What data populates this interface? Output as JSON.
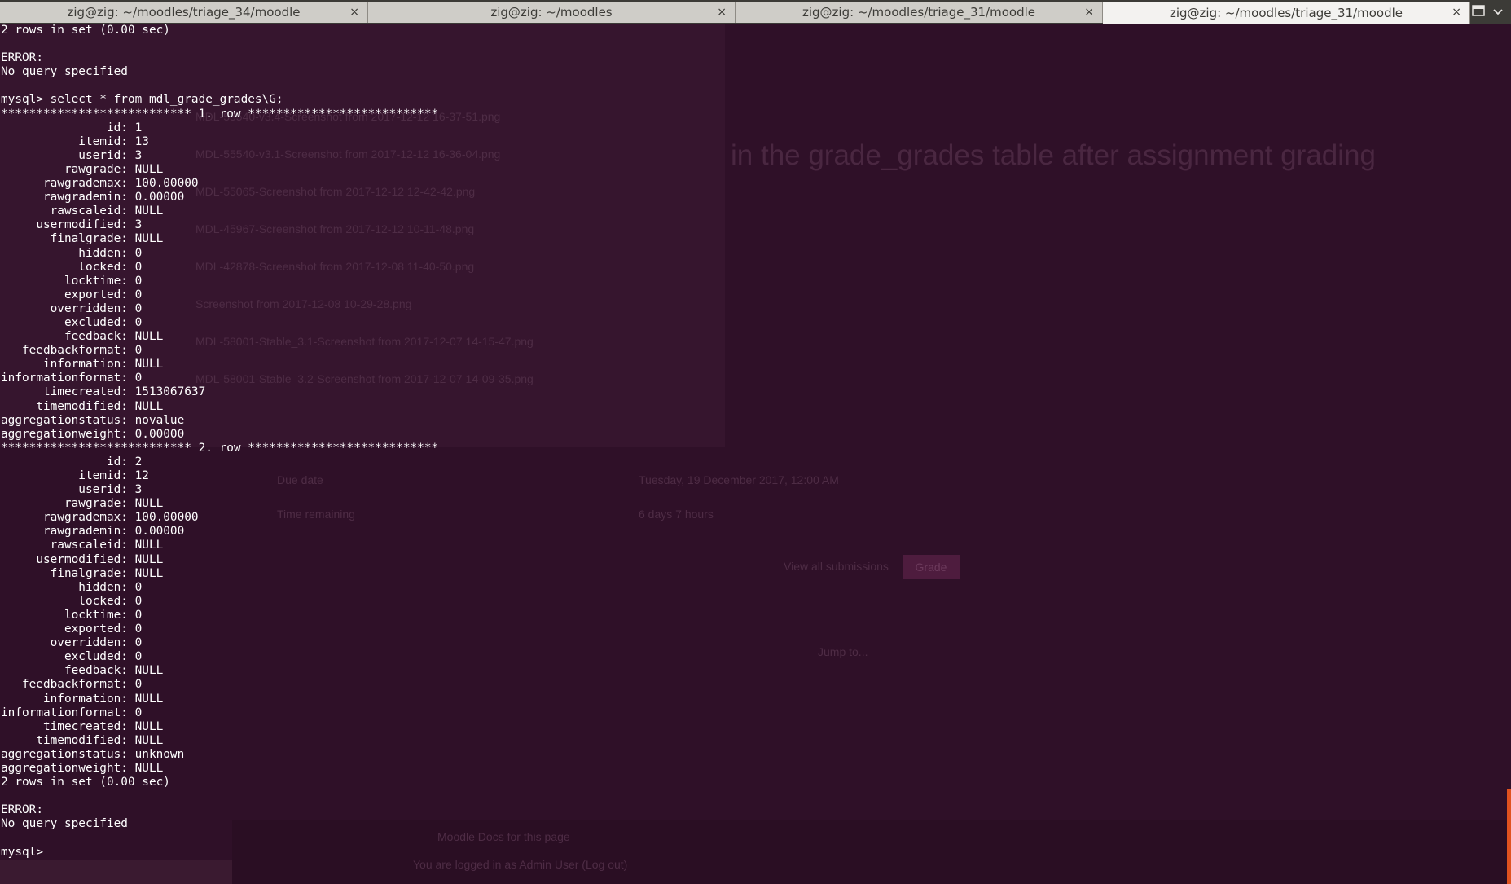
{
  "tabs": [
    {
      "title": "zig@zig: ~/moodles/triage_34/moodle",
      "active": false
    },
    {
      "title": "zig@zig: ~/moodles",
      "active": false
    },
    {
      "title": "zig@zig: ~/moodles/triage_31/moodle",
      "active": false
    },
    {
      "title": "zig@zig: ~/moodles/triage_31/moodle",
      "active": true
    }
  ],
  "close_glyph": "×",
  "tab_menu_icons": [
    "new-tab-icon",
    "chevron-down-icon"
  ],
  "colors": {
    "terminal_bg": "#2f1028",
    "terminal_text": "#ffffff",
    "tabbar_bg": "#3c3b37",
    "active_tab_bg": "#f3f2f0",
    "scrollbar_accent": "#e0521f"
  },
  "terminal": {
    "lines": [
      "2 rows in set (0.00 sec)",
      "",
      "ERROR:",
      "No query specified",
      "",
      "mysql> select * from mdl_grade_grades\\G;",
      "*************************** 1. row ***************************",
      "               id: 1",
      "           itemid: 13",
      "           userid: 3",
      "         rawgrade: NULL",
      "      rawgrademax: 100.00000",
      "      rawgrademin: 0.00000",
      "       rawscaleid: NULL",
      "     usermodified: 3",
      "       finalgrade: NULL",
      "           hidden: 0",
      "           locked: 0",
      "         locktime: 0",
      "         exported: 0",
      "       overridden: 0",
      "         excluded: 0",
      "         feedback: NULL",
      "   feedbackformat: 0",
      "      information: NULL",
      "informationformat: 0",
      "      timecreated: 1513067637",
      "     timemodified: NULL",
      "aggregationstatus: novalue",
      "aggregationweight: 0.00000",
      "*************************** 2. row ***************************",
      "               id: 2",
      "           itemid: 12",
      "           userid: 3",
      "         rawgrade: NULL",
      "      rawgrademax: 100.00000",
      "      rawgrademin: 0.00000",
      "       rawscaleid: NULL",
      "     usermodified: NULL",
      "       finalgrade: NULL",
      "           hidden: 0",
      "           locked: 0",
      "         locktime: 0",
      "         exported: 0",
      "       overridden: 0",
      "         excluded: 0",
      "         feedback: NULL",
      "   feedbackformat: 0",
      "      information: NULL",
      "informationformat: 0",
      "      timecreated: NULL",
      "     timemodified: NULL",
      "aggregationstatus: unknown",
      "aggregationweight: NULL",
      "2 rows in set (0.00 sec)",
      "",
      "ERROR:",
      "No query specified",
      "",
      "mysql> "
    ]
  },
  "background_ghost": {
    "heading": "in the grade_grades table after assignment grading",
    "files": [
      "MDL-55540-v3.4-Screenshot from 2017-12-12 16-37-51.png",
      "MDL-55540-v3.1-Screenshot from 2017-12-12 16-36-04.png",
      "MDL-55065-Screenshot from 2017-12-12 12-42-42.png",
      "MDL-45967-Screenshot from 2017-12-12 10-11-48.png",
      "MDL-42878-Screenshot from 2017-12-08 11-40-50.png",
      "Screenshot from 2017-12-08 10-29-28.png",
      "MDL-58001-Stable_3.1-Screenshot from 2017-12-07 14-15-47.png",
      "MDL-58001-Stable_3.2-Screenshot from 2017-12-07 14-09-35.png"
    ],
    "due_date_label": "Due date",
    "due_date_value": "Tuesday, 19 December 2017, 12:00 AM",
    "time_remaining_label": "Time remaining",
    "time_remaining_value": "6 days 7 hours",
    "view_submissions": "View all submissions",
    "grade_button": "Grade",
    "jump_to": "Jump to...",
    "moodle_docs": "Moodle Docs for this page",
    "logged_in": "You are logged in as Admin User (Log out)"
  }
}
